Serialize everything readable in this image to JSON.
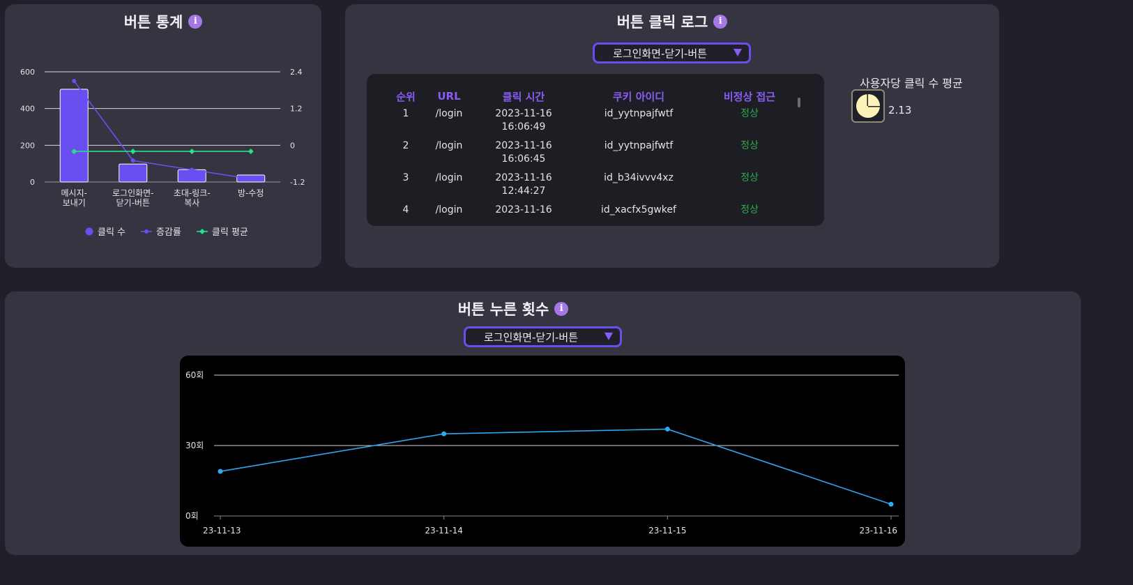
{
  "stats_panel": {
    "title": "버튼 통계",
    "chart_data": {
      "type": "bar",
      "categories": [
        "메시지-\n보내기",
        "로그인화면-\n닫기-버튼",
        "초대-링크-\n복사",
        "방-수정"
      ],
      "series": [
        {
          "name": "클릭 수",
          "type": "bar",
          "axis": "left",
          "values": [
            505,
            98,
            67,
            38
          ],
          "color": "#6a4ef0"
        },
        {
          "name": "증감률",
          "type": "line",
          "axis": "right",
          "values": [
            2.1,
            -0.5,
            -0.8,
            -1.1
          ],
          "color": "#6a4ef0"
        },
        {
          "name": "클릭 평균",
          "type": "line",
          "axis": "right",
          "values": [
            -0.2,
            -0.2,
            -0.2,
            -0.2
          ],
          "color": "#26e08a"
        }
      ],
      "left_ticks": [
        "0",
        "200",
        "400",
        "600"
      ],
      "right_ticks": [
        "-1.2",
        "0",
        "1.2",
        "2.4"
      ],
      "ylim": [
        0,
        600
      ],
      "y2lim": [
        -1.2,
        2.4
      ],
      "grid": true,
      "legend_position": "bottom"
    }
  },
  "log_panel": {
    "title": "버튼 클릭 로그",
    "dropdown": "로그인화면-닫기-버튼",
    "columns": [
      "순위",
      "URL",
      "클릭 시간",
      "쿠키 아이디",
      "비정상 접근"
    ],
    "rows": [
      {
        "rank": "1",
        "url": "/login",
        "date": "2023-11-16",
        "time": "16:06:49",
        "cookie": "id_yytnpajfwtf",
        "status": "정상"
      },
      {
        "rank": "2",
        "url": "/login",
        "date": "2023-11-16",
        "time": "16:06:45",
        "cookie": "id_yytnpajfwtf",
        "status": "정상"
      },
      {
        "rank": "3",
        "url": "/login",
        "date": "2023-11-16",
        "time": "12:44:27",
        "cookie": "id_b34ivvv4xz",
        "status": "정상"
      },
      {
        "rank": "4",
        "url": "/login",
        "date": "2023-11-16",
        "time": "",
        "cookie": "id_xacfx5gwkef",
        "status": "정상"
      }
    ],
    "avg_label": "사용자당 클릭 수 평균",
    "avg_icon": "pie-chart-icon",
    "avg_value": "2.13"
  },
  "count_panel": {
    "title": "버튼 누른 횟수",
    "dropdown": "로그인화면-닫기-버튼",
    "chart_data": {
      "type": "line",
      "x": [
        "23-11-13",
        "23-11-14",
        "23-11-15",
        "23-11-16"
      ],
      "values": [
        19,
        35,
        37,
        5
      ],
      "y_ticks": [
        "0회",
        "30회",
        "60회"
      ],
      "ylim": [
        0,
        60
      ],
      "color": "#2fa8f0",
      "grid": true
    }
  }
}
